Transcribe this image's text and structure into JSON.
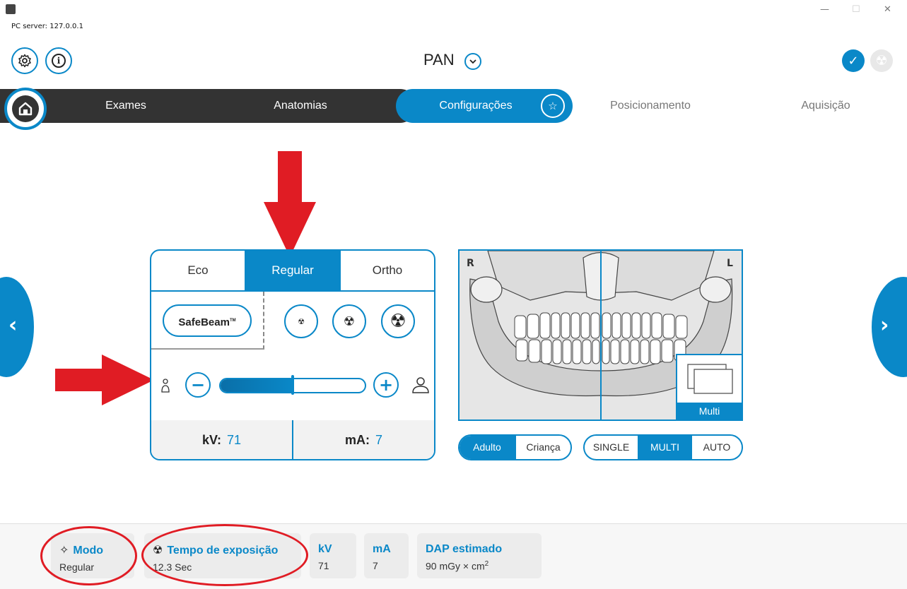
{
  "window": {
    "server_text": "PC server: 127.0.0.1",
    "minimize": "—",
    "maximize": "☐",
    "close": "✕"
  },
  "header": {
    "title": "PAN",
    "settings_icon": "gear-icon",
    "info_icon": "info-icon",
    "info_glyph": "i",
    "check_glyph": "✓",
    "radiation_glyph": "☢"
  },
  "nav": {
    "tabs": [
      {
        "label": "Exames"
      },
      {
        "label": "Anatomias"
      },
      {
        "label": "Configurações"
      },
      {
        "label": "Posicionamento"
      },
      {
        "label": "Aquisição"
      }
    ],
    "star_glyph": "☆",
    "prev_glyph": "‹",
    "next_glyph": "›"
  },
  "mode_panel": {
    "tabs": [
      {
        "label": "Eco"
      },
      {
        "label": "Regular"
      },
      {
        "label": "Ortho"
      }
    ],
    "active_tab": "Regular",
    "safebeam_label": "SafeBeam",
    "safebeam_tm": "TM",
    "dose_glyph": "☢",
    "minus_glyph": "−",
    "plus_glyph": "+",
    "slider_value_fraction": 0.5,
    "kv_label": "kV:",
    "kv_value": "71",
    "ma_label": "mA:",
    "ma_value": "7"
  },
  "image_panel": {
    "left_marker": "R",
    "right_marker": "L",
    "multi_label": "Multi"
  },
  "patient_toggle": {
    "options": [
      {
        "label": "Adulto"
      },
      {
        "label": "Criança"
      }
    ],
    "selected": "Adulto"
  },
  "acq_toggle": {
    "options": [
      {
        "label": "SINGLE"
      },
      {
        "label": "MULTI"
      },
      {
        "label": "AUTO"
      }
    ],
    "selected": "MULTI"
  },
  "summary": {
    "mode": {
      "icon_glyph": "✧",
      "title": "Modo",
      "value": "Regular"
    },
    "exposure": {
      "icon_glyph": "☢",
      "title": "Tempo de exposição",
      "value": "12.3 Sec"
    },
    "kv": {
      "title": "kV",
      "value": "71"
    },
    "ma": {
      "title": "mA",
      "value": "7"
    },
    "dap": {
      "title": "DAP estimado",
      "value": "90 mGy × cm",
      "value_sup": "2"
    }
  },
  "colors": {
    "accent": "#0a88c8",
    "dark_nav": "#333333",
    "annotation_red": "#e01c24"
  }
}
